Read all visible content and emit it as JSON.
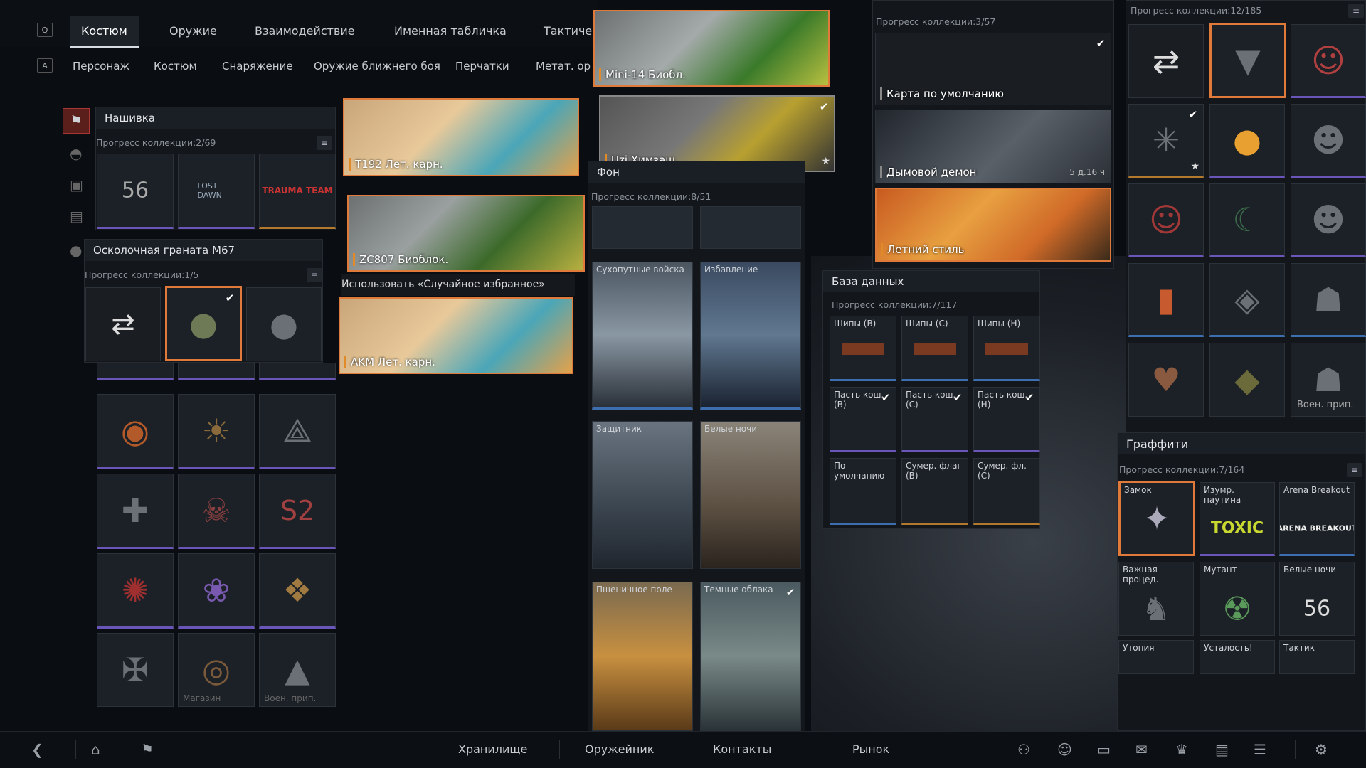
{
  "top_tabs": [
    "Костюм",
    "Оружие",
    "Взаимодействие",
    "Именная табличка",
    "Тактиче"
  ],
  "key_q": "Q",
  "key_a": "A",
  "sub_tabs": [
    "Персонаж",
    "Костюм",
    "Снаряжение",
    "Оружие ближнего боя",
    "Перчатки",
    "Метат. ор"
  ],
  "patch": {
    "title": "Нашивка",
    "progress": "Прогресс коллекции:2/69",
    "items": [
      "56",
      "LOST DAWN",
      "TRAUMA TEAM"
    ]
  },
  "grenade": {
    "title": "Осколочная граната М67",
    "progress": "Прогресс коллекции:1/5",
    "bottom_labels": [
      "Магазин",
      "Воен. прип."
    ]
  },
  "weapons": {
    "items": [
      "T192 Лет. карн.",
      "ZC807 Биоблок.",
      "AKM Лет. карн."
    ],
    "random_fav": "Использовать «Случайное избранное»"
  },
  "weapons_top": [
    "Mini-14 Биобл.",
    "Uzi Химзащ."
  ],
  "background": {
    "title": "Фон",
    "progress": "Прогресс коллекции:8/51",
    "items": [
      "Сухопутные войска",
      "Избавление",
      "Защитник",
      "Белые ночи",
      "Пшеничное поле",
      "Темные облака"
    ]
  },
  "map": {
    "progress": "Прогресс коллекции:3/57",
    "items": [
      "Карта по умолчанию",
      "Дымовой демон",
      "Летний стиль"
    ],
    "timer": "5 д.16 ч"
  },
  "database": {
    "title": "База данных",
    "progress": "Прогресс коллекции:7/117",
    "items": [
      "Шипы (B)",
      "Шипы (C)",
      "Шипы (H)",
      "Пасть кош. (B)",
      "Пасть кош. (C)",
      "Пасть кош. (H)",
      "По умолчанию",
      "Сумер. флаг (B)",
      "Сумер. фл. (C)"
    ]
  },
  "charms": {
    "progress": "Прогресс коллекции:12/185",
    "last_label": "Воен. прип."
  },
  "graffiti": {
    "title": "Граффити",
    "progress": "Прогресс коллекции:7/164",
    "items": [
      "Замок",
      "Изумр. паутина",
      "Arena Breakout",
      "Важная процед.",
      "Мутант",
      "Белые ночи",
      "Утопия",
      "Усталость!",
      "Тактик"
    ],
    "texts": [
      "TOXIC",
      "ARENA BREAKOUT",
      "56"
    ]
  },
  "bottom_nav": [
    "Хранилище",
    "Оружейник",
    "Контакты",
    "Рынок"
  ],
  "colors": {
    "accent_orange": "#e07a3a",
    "rarity_purple": "#6a55b8",
    "rarity_blue": "#3d6fb0"
  }
}
